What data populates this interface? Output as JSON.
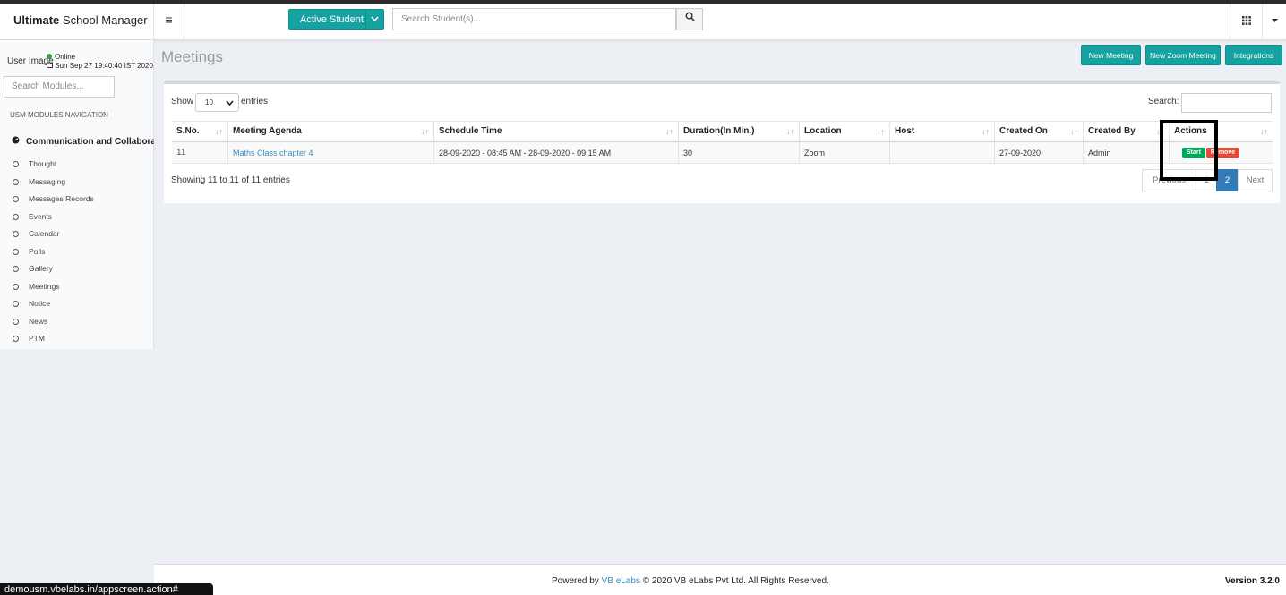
{
  "app": {
    "brand_bold": "Ultimate",
    "brand_rest": " School Manager"
  },
  "header": {
    "menu_icon": "≡",
    "student_select_label": "Active Student",
    "student_search_placeholder": "Search Student(s)..."
  },
  "sidebar": {
    "user_image_alt": "User Image",
    "status": "Online",
    "datetime": "Sun Sep 27 19:40:40 IST 2020",
    "module_search_placeholder": "Search Modules...",
    "nav_header": "USM MODULES NAVIGATION",
    "group_label": "Communication and Collaboration",
    "items": [
      {
        "label": "Thought"
      },
      {
        "label": "Messaging"
      },
      {
        "label": "Messages Records"
      },
      {
        "label": "Events"
      },
      {
        "label": "Calendar"
      },
      {
        "label": "Polls"
      },
      {
        "label": "Gallery"
      },
      {
        "label": "Meetings"
      },
      {
        "label": "Notice"
      },
      {
        "label": "News"
      },
      {
        "label": "PTM"
      }
    ]
  },
  "page": {
    "title": "Meetings",
    "buttons": {
      "new_meeting": "New Meeting",
      "new_zoom_meeting": "New Zoom Meeting",
      "integrations": "Integrations"
    }
  },
  "table": {
    "show_label": "Show",
    "page_size": "10",
    "entries_label": "entries",
    "search_label": "Search:",
    "columns": [
      "S.No.",
      "Meeting Agenda",
      "Schedule Time",
      "Duration(In Min.)",
      "Location",
      "Host",
      "Created On",
      "Created By",
      "Actions"
    ],
    "rows": [
      {
        "sno": "11",
        "agenda": "Maths Class chapter 4",
        "schedule": "28-09-2020 - 08:45 AM - 28-09-2020 - 09:15 AM",
        "duration": "30",
        "location": "Zoom",
        "host": "",
        "created_on": "27-09-2020",
        "created_by": "Admin",
        "start_label": "Start",
        "remove_label": "Remove"
      }
    ],
    "info": "Showing 11 to 11 of 11 entries",
    "pagination": {
      "previous": "Previous",
      "page1": "1",
      "page2": "2",
      "next": "Next",
      "current_page": 2
    }
  },
  "footer": {
    "powered_by": "Powered by ",
    "company_link": "VB eLabs",
    "copyright": " © 2020 VB eLabs Pvt Ltd. All Rights Reserved.",
    "version": "Version 3.2.0"
  },
  "browser_status": "demousm.vbelabs.in/appscreen.action#",
  "colors": {
    "accent_teal": "#17a2a2",
    "link_blue": "#3c8dbc",
    "start_green": "#00a65a",
    "remove_red": "#dd4b39",
    "pager_active": "#337ab7"
  },
  "icons": {
    "menu": "hamburger-icon",
    "search": "search-icon",
    "apps": "grid-icon",
    "dropdown": "caret-down-icon",
    "group": "dashboard-icon",
    "nav_item": "circle-icon",
    "sort": "sort-icon"
  }
}
